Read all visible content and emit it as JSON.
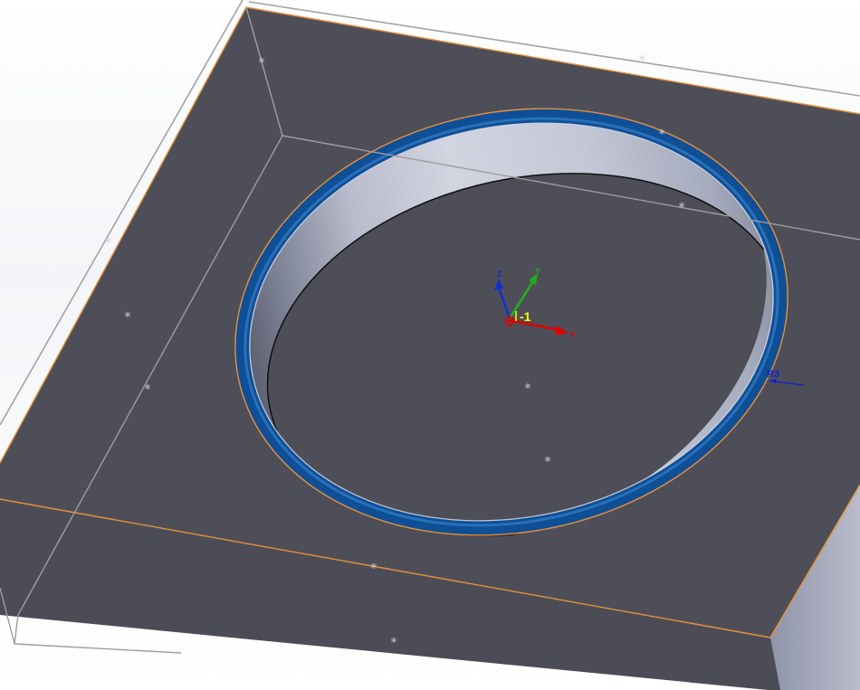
{
  "viewport": {
    "background_color": "#ffffff",
    "body_color": "#4f4f5a",
    "edge_highlight_color": "#e8913a",
    "fillet_color": "#0f4f96",
    "bounding_box_color": "#9a9a9a"
  },
  "origin": {
    "label": "-1",
    "label_color": "#ffff00"
  },
  "triad": {
    "x_label": "x",
    "y_label": "Y",
    "z_label": "Z",
    "x_color": "#e00000",
    "y_color": "#1fae1f",
    "z_color": "#1030d0"
  },
  "dimension": {
    "label": "R3",
    "color": "#0a20d0"
  }
}
